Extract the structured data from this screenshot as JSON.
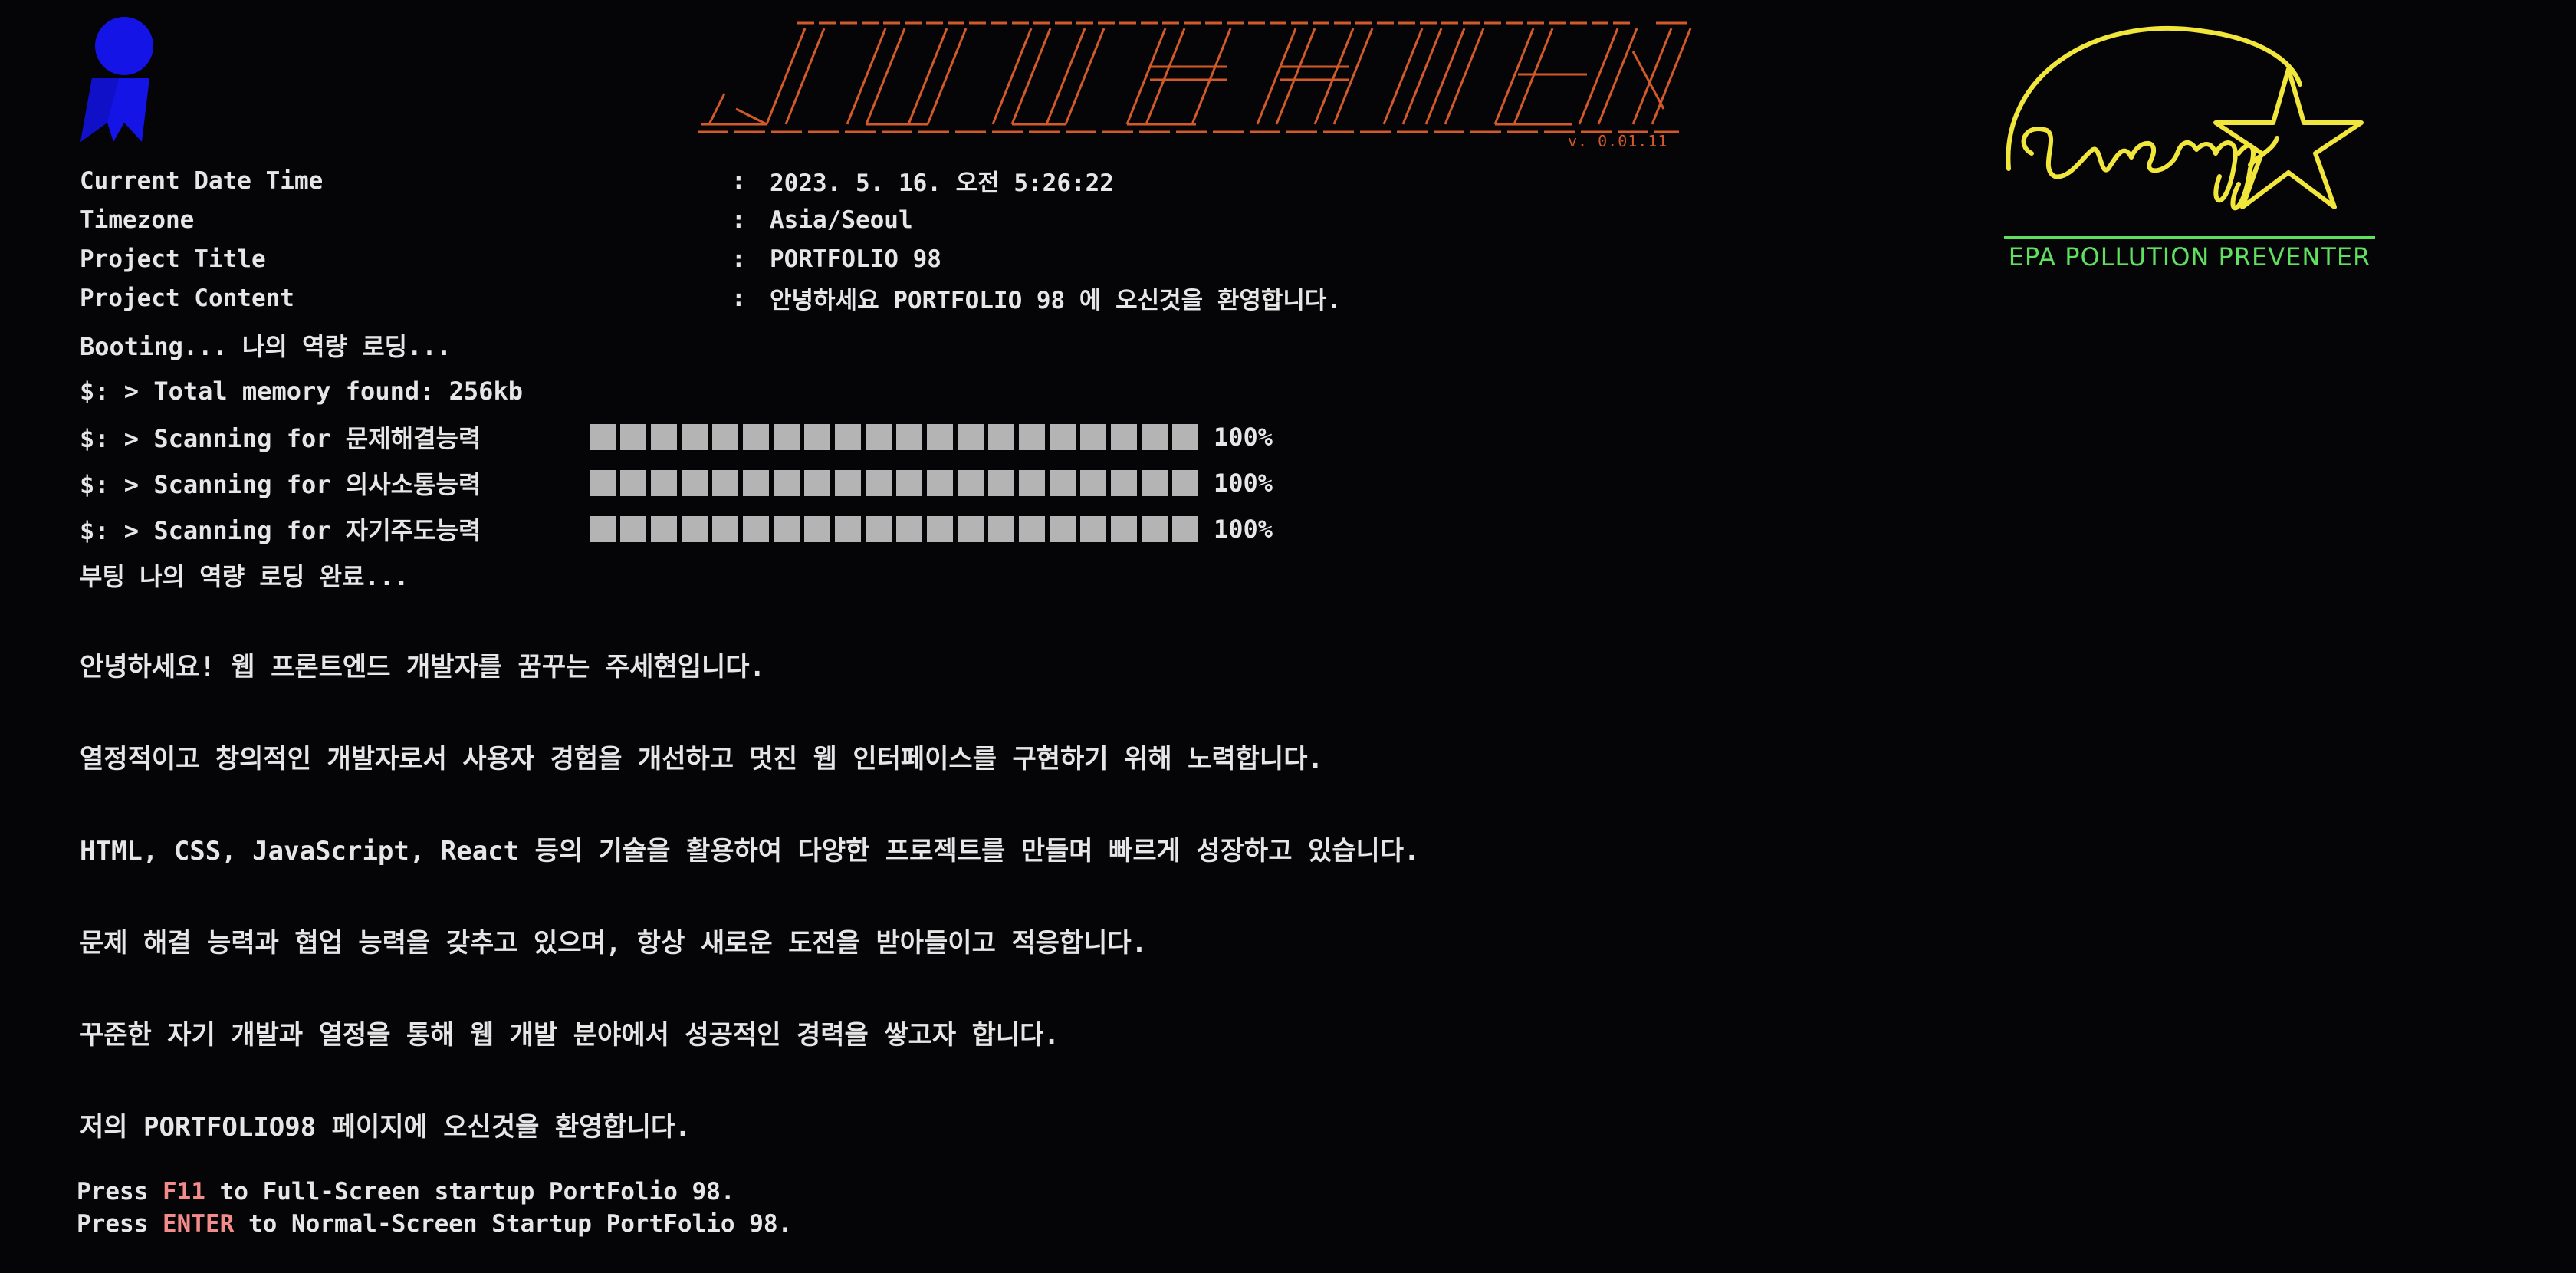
{
  "banner": {
    "version": "v. 0.01.11"
  },
  "energy": {
    "epa_text": "EPA POLLUTION PREVENTER"
  },
  "info": [
    {
      "key": "Current Date Time",
      "value": "2023. 5. 16. 오전 5:26:22"
    },
    {
      "key": "Timezone",
      "value": "Asia/Seoul"
    },
    {
      "key": "Project Title",
      "value": "PORTFOLIO 98"
    },
    {
      "key": "Project Content",
      "value": "안녕하세요 PORTFOLIO 98 에 오신것을 환영합니다."
    }
  ],
  "boot": {
    "start": "Booting... 나의 역량 로딩...",
    "memory": "$: > Total memory found: 256kb",
    "scans": [
      {
        "label": "$: > Scanning for 문제해결능력",
        "percent": "100%",
        "progress": 1.0
      },
      {
        "label": "$: > Scanning for 의사소통능력",
        "percent": "100%",
        "progress": 1.0
      },
      {
        "label": "$: > Scanning for 자기주도능력",
        "percent": "100%",
        "progress": 1.0
      }
    ],
    "done": "부팅 나의 역량 로딩 완료..."
  },
  "about": [
    "안녕하세요! 웹 프론트엔드 개발자를 꿈꾸는 주세현입니다.",
    "열정적이고 창의적인 개발자로서 사용자 경험을 개선하고 멋진 웹 인터페이스를 구현하기 위해 노력합니다.",
    "HTML, CSS, JavaScript, React 등의 기술을 활용하여 다양한 프로젝트를 만들며 빠르게 성장하고 있습니다.",
    "문제 해결 능력과 협업 능력을 갖추고 있으며, 항상 새로운 도전을 받아들이고 적응합니다.",
    "꾸준한 자기 개발과 열정을 통해 웹 개발 분야에서 성공적인 경력을 쌓고자 합니다.",
    "저의 PORTFOLIO98 페이지에 오신것을 환영합니다."
  ],
  "press": {
    "line1_prefix": "Press ",
    "line1_key": "F11",
    "line1_suffix": " to Full-Screen startup PortFolio 98.",
    "line2_prefix": "Press ",
    "line2_key": "ENTER",
    "line2_suffix": " to Normal-Screen Startup PortFolio 98."
  },
  "colors": {
    "background": "#050407",
    "text": "#e6e6e6",
    "banner": "#d25a2a",
    "energy_logo": "#f0e63c",
    "epa_text": "#5fe05f",
    "key_highlight": "#f48b8b",
    "award_logo": "#1414e6"
  },
  "icons": {
    "top_left": "award-ribbon-logo-icon",
    "top_right": "energy-star-logo-icon"
  }
}
